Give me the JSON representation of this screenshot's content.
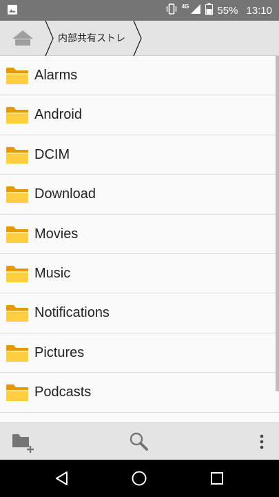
{
  "status_bar": {
    "network_label": "4G",
    "battery_percent": "55%",
    "time": "13:10",
    "icons": [
      "image-notification-icon",
      "vibrate-icon",
      "signal-icon",
      "battery-icon"
    ]
  },
  "breadcrumb": {
    "home_icon": "home-icon",
    "current": "内部共有ストレ"
  },
  "folders": [
    {
      "name": "Alarms"
    },
    {
      "name": "Android"
    },
    {
      "name": "DCIM"
    },
    {
      "name": "Download"
    },
    {
      "name": "Movies"
    },
    {
      "name": "Music"
    },
    {
      "name": "Notifications"
    },
    {
      "name": "Pictures"
    },
    {
      "name": "Podcasts"
    }
  ],
  "toolbar": {
    "icons": [
      "new-folder-icon",
      "search-icon",
      "more-vert-icon"
    ]
  },
  "nav": {
    "icons": [
      "back-icon",
      "home-circle-icon",
      "recents-icon"
    ]
  },
  "colors": {
    "status_bar": "#757575",
    "chrome": "#e4e4e4",
    "folder_fill": "#f7b500",
    "folder_front": "#ffd24d",
    "text": "#222222"
  }
}
